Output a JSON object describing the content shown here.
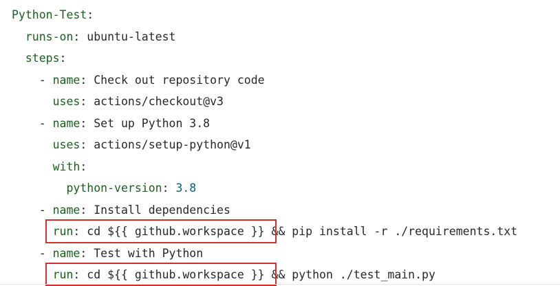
{
  "lines": [
    {
      "indent": "",
      "key": "Python-Test",
      "sep": ":",
      "value": ""
    },
    {
      "indent": "  ",
      "key": "runs-on",
      "sep": ": ",
      "value": "ubuntu-latest"
    },
    {
      "indent": "  ",
      "key": "steps",
      "sep": ":",
      "value": ""
    },
    {
      "indent": "    - ",
      "key": "name",
      "sep": ": ",
      "value": "Check out repository code"
    },
    {
      "indent": "      ",
      "key": "uses",
      "sep": ": ",
      "value": "actions/checkout@v3"
    },
    {
      "indent": "    - ",
      "key": "name",
      "sep": ": ",
      "value": "Set up Python 3.8"
    },
    {
      "indent": "      ",
      "key": "uses",
      "sep": ": ",
      "value": "actions/setup-python@v1"
    },
    {
      "indent": "      ",
      "key": "with",
      "sep": ":",
      "value": ""
    },
    {
      "indent": "        ",
      "key": "python-version",
      "sep": ": ",
      "value": "3.8"
    },
    {
      "indent": "    - ",
      "key": "name",
      "sep": ": ",
      "value": "Install dependencies"
    },
    {
      "indent": "      ",
      "key": "run",
      "sep": ": ",
      "value": "cd ${{ github.workspace }} && pip install -r ./requirements.txt"
    },
    {
      "indent": "    - ",
      "key": "name",
      "sep": ": ",
      "value": "Test with Python"
    },
    {
      "indent": "      ",
      "key": "run",
      "sep": ": ",
      "value": "cd ${{ github.workspace }} && python ./test_main.py"
    }
  ],
  "colors": {
    "highlight_border": "#d32f2f",
    "key": "#1b5e20",
    "number": "#0b5d86",
    "text": "#24292e"
  }
}
